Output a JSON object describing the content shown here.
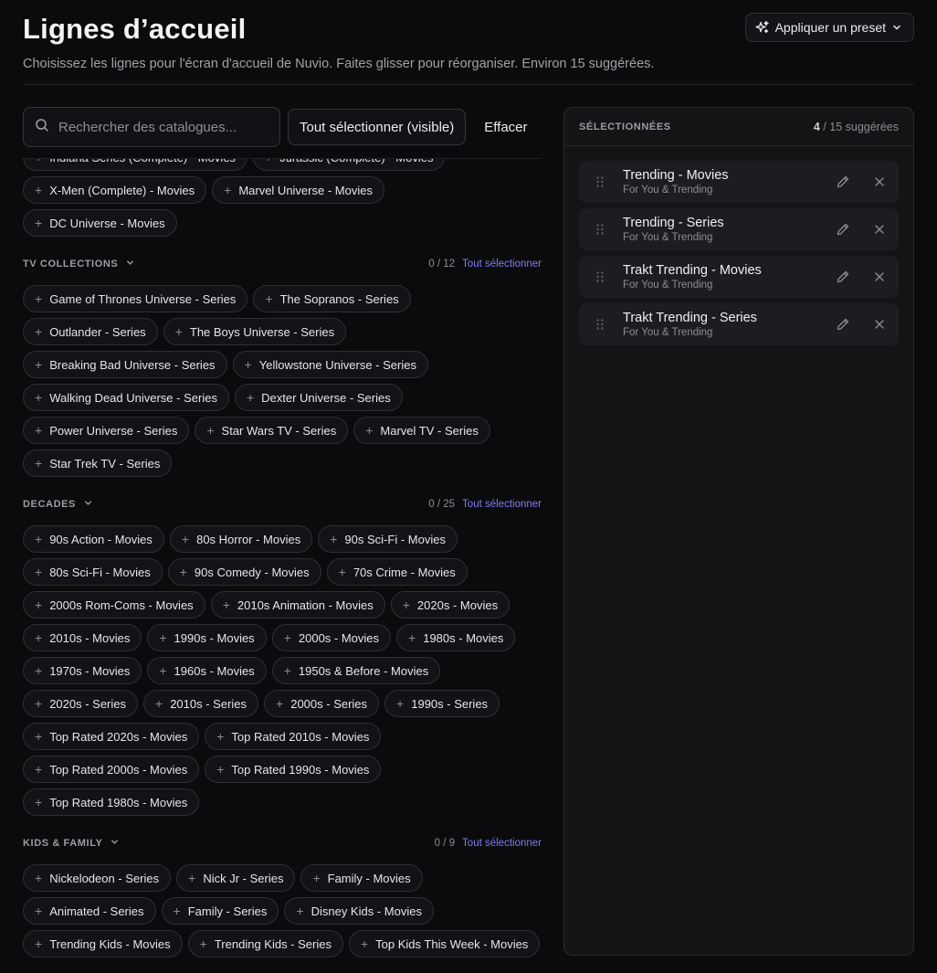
{
  "header": {
    "title": "Lignes d’accueil",
    "subtitle": "Choisissez les lignes pour l'écran d'accueil de Nuvio. Faites glisser pour réorganiser. Environ 15 suggérées.",
    "preset_label": "Appliquer un preset"
  },
  "toolbar": {
    "search_placeholder": "Rechercher des catalogues...",
    "select_visible_label": "Tout sélectionner (visible)",
    "clear_label": "Effacer"
  },
  "chip_plus": "+",
  "top_chips": [
    "Indiana Series (Complete) - Movies",
    "Jurassic (Complete) - Movies",
    "X-Men (Complete) - Movies",
    "Marvel Universe - Movies",
    "DC Universe - Movies"
  ],
  "sections": [
    {
      "title": "TV COLLECTIONS",
      "count": "0 / 12",
      "select_all": "Tout sélectionner",
      "chips": [
        "Game of Thrones Universe - Series",
        "The Sopranos - Series",
        "Outlander - Series",
        "The Boys Universe - Series",
        "Breaking Bad Universe - Series",
        "Yellowstone Universe - Series",
        "Walking Dead Universe - Series",
        "Dexter Universe - Series",
        "Power Universe - Series",
        "Star Wars TV - Series",
        "Marvel TV - Series",
        "Star Trek TV - Series"
      ]
    },
    {
      "title": "DECADES",
      "count": "0 / 25",
      "select_all": "Tout sélectionner",
      "chips": [
        "90s Action - Movies",
        "80s Horror - Movies",
        "90s Sci-Fi - Movies",
        "80s Sci-Fi - Movies",
        "90s Comedy - Movies",
        "70s Crime - Movies",
        "2000s Rom-Coms - Movies",
        "2010s Animation - Movies",
        "2020s - Movies",
        "2010s - Movies",
        "1990s - Movies",
        "2000s - Movies",
        "1980s - Movies",
        "1970s - Movies",
        "1960s - Movies",
        "1950s & Before - Movies",
        "2020s - Series",
        "2010s - Series",
        "2000s - Series",
        "1990s - Series",
        "Top Rated 2020s - Movies",
        "Top Rated 2010s - Movies",
        "Top Rated 2000s - Movies",
        "Top Rated 1990s - Movies",
        "Top Rated 1980s - Movies"
      ]
    },
    {
      "title": "KIDS & FAMILY",
      "count": "0 / 9",
      "select_all": "Tout sélectionner",
      "chips": [
        "Nickelodeon - Series",
        "Nick Jr - Series",
        "Family - Movies",
        "Animated - Series",
        "Family - Series",
        "Disney Kids - Movies",
        "Trending Kids - Movies",
        "Trending Kids - Series",
        "Top Kids This Week - Movies"
      ]
    }
  ],
  "selected": {
    "title": "SÉLECTIONNÉES",
    "count_current": "4",
    "count_rest": "/ 15 suggérées",
    "items": [
      {
        "name": "Trending - Movies",
        "sub": "For You & Trending"
      },
      {
        "name": "Trending - Series",
        "sub": "For You & Trending"
      },
      {
        "name": "Trakt Trending - Movies",
        "sub": "For You & Trending"
      },
      {
        "name": "Trakt Trending - Series",
        "sub": "For You & Trending"
      }
    ]
  },
  "icons": {
    "preset": "sparkles-icon",
    "chevron": "chevron-down-icon",
    "search": "search-icon",
    "plus": "plus-icon",
    "grip": "drag-handle-icon",
    "edit": "pencil-icon",
    "remove": "close-icon"
  },
  "colors": {
    "background": "#0b0b0d",
    "panel": "#141417",
    "accent": "#7c7cf4"
  }
}
